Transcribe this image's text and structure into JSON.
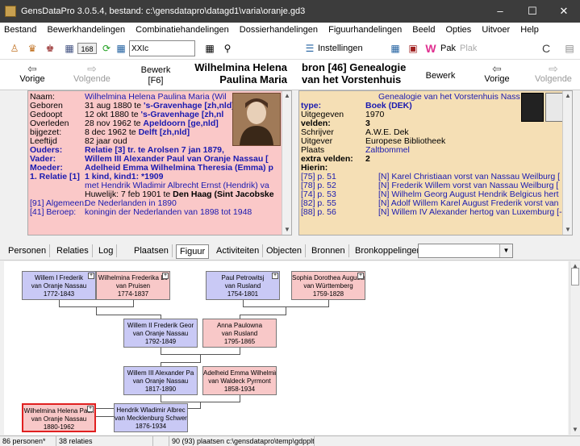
{
  "window": {
    "title": "GensDataPro 3.0.5.4, bestand: c:\\gensdatapro\\datagd1\\varia\\oranje.gd3",
    "min": "–",
    "max": "☐",
    "close": "✕"
  },
  "menu": [
    "Bestand",
    "Bewerkhandelingen",
    "Combinatiehandelingen",
    "Dossierhandelingen",
    "Figuurhandelingen",
    "Beeld",
    "Opties",
    "Uitvoer",
    "Help"
  ],
  "toolbar": {
    "count_label": "168",
    "search_value": "XXIc",
    "instellingen": "Instellingen",
    "pak": "Pak",
    "plak": "Plak",
    "refresh": "C"
  },
  "nav": {
    "vorige_left": "Vorige",
    "volgende_left": "Volgende",
    "bewerk_left": "Bewerk",
    "bewerk_left_key": "[F6]",
    "person_head_1": "Wilhelmina Helena",
    "person_head_2": "Paulina Maria",
    "source_head_1": "bron [46] Genealogie",
    "source_head_2": "van het Vorstenhuis",
    "bewerk_right": "Bewerk",
    "vorige_right": "Vorige",
    "volgende_right": "Volgende"
  },
  "person": {
    "rows": [
      {
        "label": "Naam:",
        "value": "Wilhelmina Helena Paulina Maria (Wil"
      },
      {
        "label": "Geboren",
        "value": "31 aug 1880 te ",
        "place": "'s-Gravenhage [zh,nld]"
      },
      {
        "label": "Gedoopt",
        "value": "12 okt 1880 te ",
        "place": "'s-Gravenhage [zh,nl"
      },
      {
        "label": "Overleden",
        "value": "28 nov 1962 te ",
        "place": "Apeldoorn [ge,nld]"
      },
      {
        "label": "bijgezet:",
        "value": "8 dec 1962 te ",
        "place": "Delft [zh,nld]"
      },
      {
        "label": "Leeftijd",
        "value": "82 jaar oud"
      },
      {
        "label": "Ouders:",
        "value": "Relatie [3] tr. te Arolsen 7 jan 1879,"
      },
      {
        "label": "Vader:",
        "value": "Willem III Alexander Paul van Oranje Nassau ["
      },
      {
        "label": "Moeder:",
        "value": "Adelheid Emma Wilhelmina Theresia (Emma) p"
      },
      {
        "label": "1. Relatie [1]",
        "value": "1 kind, kind1: *1909"
      },
      {
        "label": "",
        "value": "met Hendrik Wladimir Albrecht Ernst (Hendrik) va"
      },
      {
        "label": "",
        "value": "Huwelijk: 7 feb 1901 te ",
        "place": "Den Haag (Sint Jacobske"
      },
      {
        "label": "[91] Algemeen:",
        "value": "De Nederlanden in 1890"
      },
      {
        "label": "[41] Beroep:",
        "value": "koningin der Nederlanden van 1898 tot 1948"
      }
    ]
  },
  "source": {
    "title_line": "Genealogie van het Vorstenhuis Nass",
    "rows": [
      {
        "label": "type:",
        "value": "Boek (DEK)"
      },
      {
        "label": "Uitgegeven",
        "value": "1970"
      },
      {
        "label": "velden:",
        "value": "3"
      },
      {
        "label": "Schrijver",
        "value": "A.W.E. Dek"
      },
      {
        "label": "Uitgever",
        "value": "Europese Bibliotheek"
      },
      {
        "label": "Plaats",
        "value": "Zaltbommel"
      },
      {
        "label": "extra velden:",
        "value": "2"
      },
      {
        "label": "Hierin:",
        "value": ""
      },
      {
        "label": "[75] p. 51",
        "value": "[N] Karel Christiaan vorst van Nassau Weilburg ["
      },
      {
        "label": "[78] p. 52",
        "value": "[N] Frederik Willem vorst van Nassau Weilburg ["
      },
      {
        "label": "[74] p. 53",
        "value": "[N] Wilhelm Georg August Hendrik Belgicus hert"
      },
      {
        "label": "[82] p. 55",
        "value": "[N] Adolf Willem Karel August Frederik vorst van"
      },
      {
        "label": "[88] p. 56",
        "value": "[N] Willem IV Alexander hertog van Luxemburg [-"
      }
    ]
  },
  "tabs": [
    "Personen",
    "Relaties",
    "Log",
    "Plaatsen",
    "Figuur",
    "Activiteiten",
    "Objecten",
    "Bronnen",
    "Bronkoppelingen"
  ],
  "active_tab": "Figuur",
  "tree": {
    "nodes": [
      {
        "id": "n1",
        "sex": "m",
        "l1": "Willem I Frederik",
        "l2": "van Oranje Nassau",
        "l3": "1772-1843"
      },
      {
        "id": "n2",
        "sex": "f",
        "l1": "Wilhelmina Frederika Lo",
        "l2": "van Pruisen",
        "l3": "1774-1837"
      },
      {
        "id": "n3",
        "sex": "m",
        "l1": "Paul Petrowitsj",
        "l2": "van Rusland",
        "l3": "1754-1801"
      },
      {
        "id": "n4",
        "sex": "f",
        "l1": "Sophia Dorothea Augusta",
        "l2": "van Württemberg",
        "l3": "1759-1828"
      },
      {
        "id": "n5",
        "sex": "m",
        "l1": "Willem II Frederik Geor",
        "l2": "van Oranje Nassau",
        "l3": "1792-1849"
      },
      {
        "id": "n6",
        "sex": "f",
        "l1": "Anna Paulowna",
        "l2": "van Rusland",
        "l3": "1795-1865"
      },
      {
        "id": "n7",
        "sex": "m",
        "l1": "Willem III Alexander Pa",
        "l2": "van Oranje Nassau",
        "l3": "1817-1890"
      },
      {
        "id": "n8",
        "sex": "f",
        "l1": "Adelheid Emma Wilhelmin",
        "l2": "van Waldeck Pyrmont",
        "l3": "1858-1934"
      },
      {
        "id": "n9",
        "sex": "f",
        "l1": "Wilhelmina Helena Pauli",
        "l2": "van Oranje Nassau",
        "l3": "1880-1962"
      },
      {
        "id": "n10",
        "sex": "m",
        "l1": "Hendrik Wladimir Albrec",
        "l2": "van Mecklenburg Schweri",
        "l3": "1876-1934"
      }
    ],
    "plus": "+"
  },
  "status": {
    "personen": "86 personen*",
    "relaties": "38 relaties",
    "info": "90 (93) plaatsen c:\\gensdatapro\\temp\\gdpplt.c"
  }
}
